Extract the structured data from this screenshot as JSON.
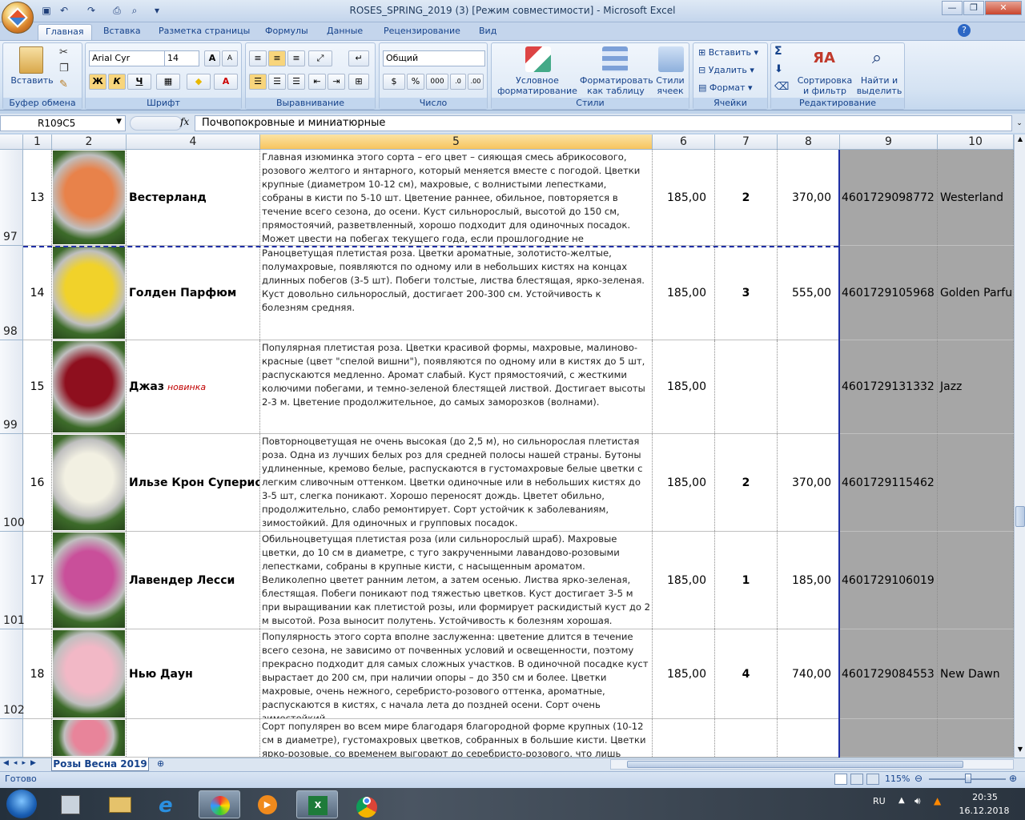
{
  "window": {
    "title": "ROSES_SPRING_2019 (3)  [Режим совместимости] - Microsoft Excel",
    "min_label": "—",
    "max_label": "❐",
    "close_label": "✕"
  },
  "ribbon_tabs": [
    "Главная",
    "Вставка",
    "Разметка страницы",
    "Формулы",
    "Данные",
    "Рецензирование",
    "Вид"
  ],
  "ribbon": {
    "clipboard": {
      "paste_label": "Вставить",
      "group_label": "Буфер обмена"
    },
    "font": {
      "name": "Arial Cyr",
      "size": "14",
      "group_label": "Шрифт",
      "bold": "Ж",
      "italic": "К",
      "underline": "Ч"
    },
    "alignment": {
      "group_label": "Выравнивание"
    },
    "number": {
      "format": "Общий",
      "group_label": "Число",
      "percent": "%",
      "thousands": "000"
    },
    "styles": {
      "cond_format": "Условное форматирование",
      "format_table": "Форматировать как таблицу",
      "cell_styles": "Стили ячеек",
      "group_label": "Стили"
    },
    "cells": {
      "insert": "Вставить",
      "delete": "Удалить",
      "format": "Формат",
      "group_label": "Ячейки"
    },
    "editing": {
      "sort": "Сортировка и фильтр",
      "find": "Найти и выделить",
      "group_label": "Редактирование",
      "sum": "Σ"
    }
  },
  "formula_bar": {
    "name_box": "R109C5",
    "fx": "fx",
    "value": "Почвопокровные и миниатюрные"
  },
  "columns": [
    "1",
    "2",
    "4",
    "5",
    "6",
    "7",
    "8",
    "9",
    "10"
  ],
  "rows": [
    {
      "header": "97",
      "num": "13",
      "name": "Вестерланд",
      "tag": "",
      "desc": "Главная изюминка этого сорта – его цвет – сияющая смесь абрикосового, розового желтого и янтарного, который меняется вместе с погодой. Цветки крупные (диаметром 10-12 см), махровые, с волнистыми лепестками, собраны в кисти по 5-10 шт. Цветение раннее, обильное, повторяется в течение всего сезона, до осени. Куст сильнорослый, высотой до 150 см, прямостоячий, разветвленный, хорошо подходит для одиночных посадок. Может цвести на побегах текущего года, если прошлогодние не сохранились.",
      "price": "185,00",
      "qty": "2",
      "sum": "370,00",
      "code": "4601729098772",
      "latin": "Westerland",
      "color": "#e8824a"
    },
    {
      "header": "98",
      "num": "14",
      "name": "Голден Парфюм",
      "tag": "",
      "desc": "Раноцветущая плетистая роза. Цветки ароматные, золотисто-желтые, полумахровые, появляются по одному или в небольших кистях на концах длинных побегов (3-5 шт). Побеги толстые, листва блестящая, ярко-зеленая. Куст довольно сильнорослый, достигает 200-300 см. Устойчивость к болезням средняя.",
      "price": "185,00",
      "qty": "3",
      "sum": "555,00",
      "code": "4601729105968",
      "latin": "Golden Parfum",
      "color": "#f1d22a"
    },
    {
      "header": "99",
      "num": "15",
      "name": "Джаз",
      "tag": "новинка",
      "desc": "Популярная плетистая роза. Цветки красивой формы, махровые, малиново-красные (цвет \"спелой вишни\"), появляются по одному или в кистях до 5 шт, распускаются медленно. Аромат слабый. Куст прямостоячий, с жесткими колючими побегами, и темно-зеленой блестящей листвой. Достигает высоты 2-3 м. Цветение продолжительное, до самых заморозков (волнами).",
      "price": "185,00",
      "qty": "",
      "sum": "",
      "code": "4601729131332",
      "latin": "Jazz",
      "color": "#8e0f1e"
    },
    {
      "header": "100",
      "num": "16",
      "name": "Ильзе Крон Супериор",
      "tag": "",
      "desc": "Повторноцветущая не очень высокая (до 2,5 м), но сильнорослая плетистая роза. Одна из лучших белых роз для средней полосы нашей страны. Бутоны удлиненные, кремово белые, распускаются в густомахровые белые цветки с легким сливочным оттенком. Цветки одиночные или в небольших кистях до 3-5 шт, слегка поникают. Хорошо переносят дождь. Цветет обильно, продолжительно, слабо ремонтирует. Сорт устойчик к заболеваниям, зимостойкий. Для одиночных и групповых посадок.",
      "price": "185,00",
      "qty": "2",
      "sum": "370,00",
      "code": "4601729115462",
      "latin": "",
      "color": "#f2f0e2"
    },
    {
      "header": "101",
      "num": "17",
      "name": "Лавендер Лесси",
      "tag": "",
      "desc": "Обильноцветущая плетистая роза (или сильнорослый шраб). Махровые цветки, до 10 см в диаметре, с туго закрученными лавандово-розовыми лепестками, собраны в крупные кисти, с насыщенным ароматом. Великолепно цветет ранним летом, а затем осенью. Листва ярко-зеленая, блестящая. Побеги поникают под тяжестью цветков. Куст достигает 3-5 м при выращивании как плетистой розы, или формирует раскидистый куст до 2 м высотой. Роза выносит полутень. Устойчивость к болезням хорошая.",
      "price": "185,00",
      "qty": "1",
      "sum": "185,00",
      "code": "4601729106019",
      "latin": "",
      "color": "#c94f9a"
    },
    {
      "header": "102",
      "num": "18",
      "name": "Нью Даун",
      "tag": "",
      "desc": "Популярность этого сорта вполне заслуженна: цветение длится в течение всего сезона, не зависимо от почвенных условий и освещенности,  поэтому прекрасно подходит для самых сложных участков. В одиночной посадке куст вырастает до 200 см, при наличии опоры – до 350 см и более. Цветки махровые, очень нежного, серебристо-розового оттенка, ароматные, распускаются в кистях, с начала лета до поздней осени. Сорт очень зимостойкий.",
      "price": "185,00",
      "qty": "4",
      "sum": "740,00",
      "code": "4601729084553",
      "latin": "New Dawn",
      "color": "#f2b8c6"
    },
    {
      "header": "",
      "num": "",
      "name": "",
      "tag": "",
      "desc": "Сорт популярен во всем мире благодаря благородной форме крупных (10-12 см в диаметре), густомахровых цветков, собранных в большие кисти. Цветки ярко-розовые, со временем выгорают до серебристо-розового, что лишь подчеркивает",
      "price": "",
      "qty": "",
      "sum": "",
      "code": "",
      "latin": "",
      "color": "#e8849a"
    }
  ],
  "sheet_tab": "Розы Весна 2019",
  "status": {
    "ready": "Готово",
    "zoom": "115%"
  },
  "taskbar": {
    "lang": "RU",
    "time": "20:35",
    "date": "16.12.2018"
  }
}
